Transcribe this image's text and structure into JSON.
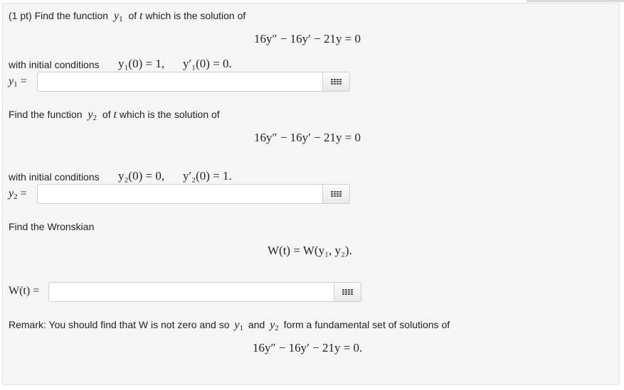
{
  "problem": {
    "header": "(1 pt) Find the function",
    "header_var": "y",
    "header_var_sub": "1",
    "header_of": "of",
    "header_t": "t",
    "header_rest": "which is the solution of",
    "equation": "16y″ − 16y′ − 21y = 0"
  },
  "part1": {
    "ic_label": "with initial conditions",
    "ic_a": "y₁(0) = 1,",
    "ic_b": "y′₁(0) = 0.",
    "answer_label_var": "y",
    "answer_label_sub": "1",
    "answer_label_eq": " =",
    "answer_value": "",
    "button": "equation-editor"
  },
  "part2": {
    "prompt": "Find the function",
    "var": "y",
    "var_sub": "2",
    "of": "of",
    "t": "t",
    "rest": "which is the solution of",
    "equation": "16y″ − 16y′ − 21y = 0",
    "ic_label": "with initial conditions",
    "ic_a": "y₂(0) = 0,",
    "ic_b": "y′₂(0) = 1.",
    "answer_label_var": "y",
    "answer_label_sub": "2",
    "answer_label_eq": " =",
    "answer_value": ""
  },
  "part3": {
    "prompt": "Find the Wronskian",
    "equation": "W(t) = W(y₁, y₂).",
    "answer_label": "W(t) =",
    "answer_value": ""
  },
  "remark": {
    "text_a": "Remark: You should find that W is not zero and so",
    "y1": "y",
    "y1_sub": "1",
    "and": "and",
    "y2": "y",
    "y2_sub": "2",
    "text_b": "form a fundamental set of solutions of",
    "equation": "16y″ − 16y′ − 21y = 0."
  },
  "colors": {
    "panel_bg": "#f5f5f5",
    "border": "#cfcfcf"
  }
}
